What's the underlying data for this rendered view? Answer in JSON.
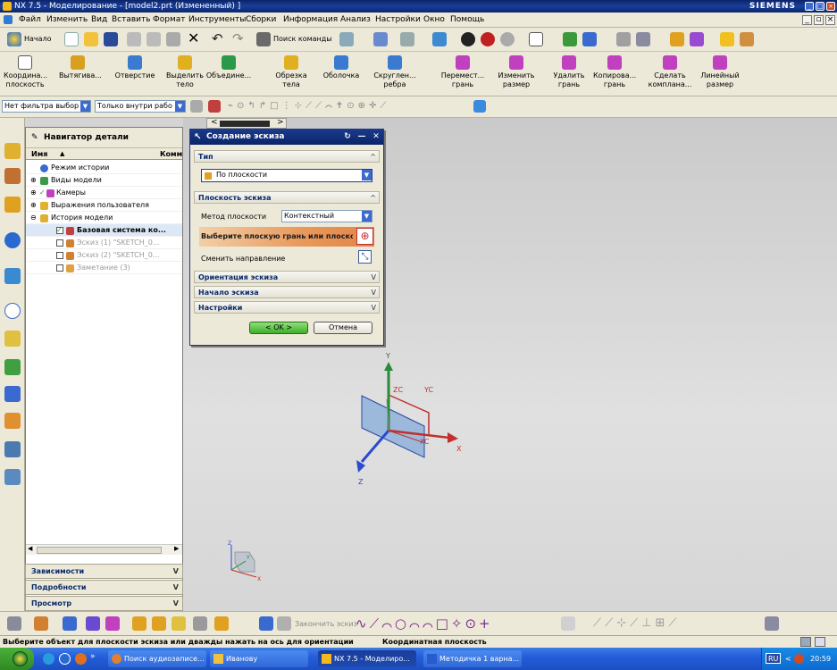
{
  "window": {
    "title": "NX 7.5 - Моделирование - [model2.prt (Измененный) ]",
    "brand": "SIEMENS"
  },
  "menu": [
    "Файл",
    "Изменить",
    "Вид",
    "Вставить",
    "Формат",
    "Инструменты",
    "Сборки",
    "Информация",
    "Анализ",
    "Настройки",
    "Окно",
    "Помощь"
  ],
  "toolbar1": {
    "start_label": "Начало",
    "command_search": "Поиск команды"
  },
  "toolbar2": [
    "Координа... плоскость",
    "Вытягива...",
    "Отверстие",
    "Выделить тело",
    "Объедине...",
    "Обрезка тела",
    "Оболочка",
    "Скруглен... ребра",
    "Перемест... грань",
    "Изменить размер",
    "Удалить грань",
    "Копирова... грань",
    "Сделать компланa...",
    "Линейный размер"
  ],
  "toolbar3": {
    "filter": "Нет фильтра выбор",
    "scope": "Только внутри рабо"
  },
  "navigator": {
    "title": "Навигатор детали",
    "col_name": "Имя",
    "col_comment": "Комм",
    "rows": [
      "Режим истории",
      "Виды модели",
      "Камеры",
      "Выражения пользователя",
      "История модели",
      "Базовая система ко...",
      "Эскиз (1) \"SKETCH_0...",
      "Эскиз (2) \"SKETCH_0...",
      "Заметание (3)"
    ],
    "sections": [
      "Зависимости",
      "Подробности",
      "Просмотр"
    ]
  },
  "dialog": {
    "title": "Создание эскиза",
    "type_section": "Тип",
    "type_value": "По плоскости",
    "plane_section": "Плоскость эскиза",
    "method_label": "Метод плоскости",
    "method_value": "Контекстный",
    "select_prompt": "Выберите плоскую грань или плоскость (",
    "flip_label": "Сменить направление",
    "orient_section": "Ориентация эскиза",
    "origin_section": "Начало эскиза",
    "settings_section": "Настройки",
    "ok": "< OK >",
    "cancel": "Отмена"
  },
  "axes": {
    "y": "Y",
    "x": "X",
    "z": "Z",
    "yc": "YC",
    "zc": "ZC",
    "xc": "XC"
  },
  "mini_axes": {
    "z": "Z",
    "y": "Y",
    "x": "X"
  },
  "bottom_toolbar": {
    "finish_sketch": "Закончить эскиз"
  },
  "status": {
    "prompt": "Выберите объект для плоскости эскиза или дважды нажать на ось для ориентации",
    "info": "Координатная плоскость"
  },
  "taskbar": {
    "items": [
      "Поиск аудиозаписе...",
      "Иванову",
      "NX 7.5 - Моделиро...",
      "Методичка 1 варна..."
    ],
    "lang": "RU",
    "time": "20:59"
  }
}
